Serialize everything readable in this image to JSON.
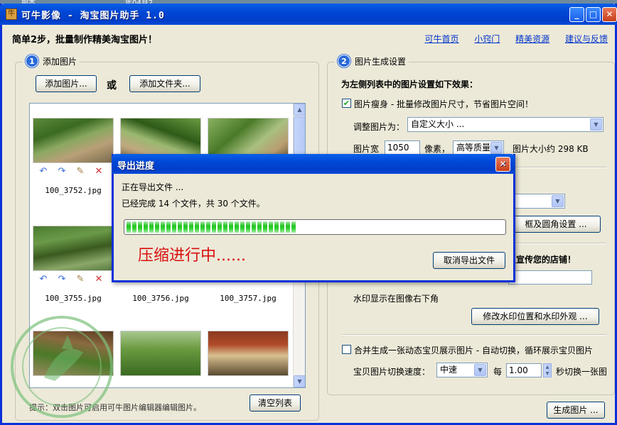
{
  "desktop": {
    "texts": [
      "副本",
      "年04月2"
    ]
  },
  "window": {
    "title": "可牛影像 - 淘宝图片助手 1.0",
    "controls": {
      "minimize": "_",
      "maximize": "□",
      "close": "✕"
    }
  },
  "header": {
    "tagline": "简单2步，批量制作精美淘宝图片！",
    "links": [
      "可牛首页",
      "小窍门",
      "精美资源",
      "建议与反馈"
    ]
  },
  "left_panel": {
    "step_number": "1",
    "title": "添加图片",
    "add_images_label": "添加图片...",
    "or_label": "或",
    "add_folder_label": "添加文件夹...",
    "thumbnails": [
      {
        "name": "100_3752.jpg"
      },
      {
        "name": ""
      },
      {
        "name": ""
      },
      {
        "name": "100_3755.jpg"
      },
      {
        "name": "100_3756.jpg"
      },
      {
        "name": "100_3757.jpg"
      },
      {
        "name": ""
      },
      {
        "name": ""
      },
      {
        "name": ""
      }
    ],
    "hint": "提示：双击图片可启用可牛图片编辑器编辑图片。",
    "clear_list_label": "清空列表"
  },
  "right_panel": {
    "step_number": "2",
    "title": "图片生成设置",
    "subtitle": "为左侧列表中的图片设置如下效果：",
    "slim_label": "图片瘦身 - 批量修改图片尺寸，节省图片空间！",
    "slim_checked": true,
    "resize_label": "调整图片为：",
    "resize_value": "自定义大小 ...",
    "width_label": "图片宽",
    "width_value": "1050",
    "pixel_label": "像素，",
    "quality_value": "高等质量",
    "size_estimate": "图片大小约 298 KB",
    "frame_button": "框及圆角设置 ...",
    "watermark_prompt": "以宣传您的店铺！",
    "watermark_position": "水印显示在图像右下角",
    "watermark_button": "修改水印位置和水印外观 ...",
    "merge_label": "合并生成一张动态宝贝展示图片 - 自动切换，循环展示宝贝图片",
    "merge_checked": false,
    "speed_label": "宝贝图片切换速度：",
    "speed_value": "中速",
    "every_label": "每",
    "seconds_value": "1.00",
    "per_label": "秒切换一张图",
    "generate_label": "生成图片 ..."
  },
  "dialog": {
    "title": "导出进度",
    "line1": "正在导出文件 ...",
    "line2": "已经完成 14 个文件，共 30 个文件。",
    "progress_done": 14,
    "progress_total": 30,
    "status": "压缩进行中......",
    "cancel_label": "取消导出文件"
  },
  "colors": {
    "titlebar": "#0047d6",
    "link": "#0033cc",
    "progress": "#22c422",
    "status_red": "#d81010"
  }
}
